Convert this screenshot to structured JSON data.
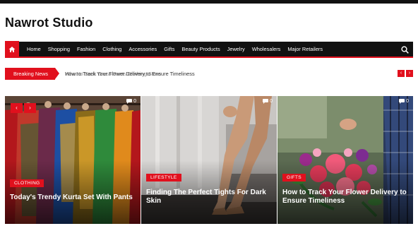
{
  "site": {
    "brand": "Nawrot Studio"
  },
  "nav": {
    "home_icon": "home-icon",
    "items": [
      "Home",
      "Shopping",
      "Fashion",
      "Clothing",
      "Accessories",
      "Gifts",
      "Beauty Products",
      "Jewelry",
      "Wholesalers",
      "Major Retailers"
    ],
    "search_icon": "search-icon"
  },
  "breaking": {
    "label": "Breaking News",
    "headline": "How to Track Your Flower Delivery to Ensure Timeliness",
    "ghost_headline": "What to Seek Dress Pants Clothing Store",
    "prev": "‹",
    "next": "›"
  },
  "slider": {
    "prev": "‹",
    "next": "›"
  },
  "cards": [
    {
      "category": "Clothing",
      "title": "Today's Trendy Kurta Set With Pants",
      "comments": "0"
    },
    {
      "category": "Lifestyle",
      "title": "Finding The Perfect Tights For Dark Skin",
      "comments": "0"
    },
    {
      "category": "Gifts",
      "title": "How to Track Your Flower Delivery to Ensure Timeliness",
      "comments": "0"
    }
  ],
  "colors": {
    "accent": "#e1101d",
    "nav_bg": "#111111"
  }
}
